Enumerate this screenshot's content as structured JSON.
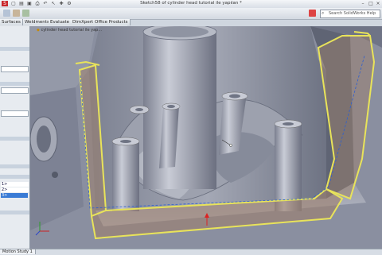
{
  "window": {
    "title": "Sketch58 of cylinder head tutorial ile yapılan *"
  },
  "search": {
    "placeholder": "Search SolidWorks Help"
  },
  "tabs": [
    {
      "label": "Surfaces"
    },
    {
      "label": "Weldments"
    },
    {
      "label": "Evaluate"
    },
    {
      "label": "DimXpert"
    },
    {
      "label": "Office Products"
    }
  ],
  "breadcrumb": {
    "label": "cylinder head tutorial ile yap..."
  },
  "left_pane": {
    "list_items": [
      "1>",
      "2>",
      "3>"
    ]
  },
  "statusbar": {
    "motion_tab": "Motion Study 1"
  },
  "colors": {
    "model_body": "#8f94a3",
    "model_dark": "#5e6373",
    "model_light": "#c3c7d2",
    "highlight_yellow": "#e8e35a",
    "wall_brown": "#9c7f6c",
    "selection_blue": "#3a7bd5"
  },
  "icons": [
    "solidworks-logo-icon",
    "new-icon",
    "open-icon",
    "save-icon",
    "print-icon",
    "undo-icon",
    "select-icon",
    "rebuild-icon",
    "options-icon",
    "search-icon",
    "view-triad-icon"
  ]
}
